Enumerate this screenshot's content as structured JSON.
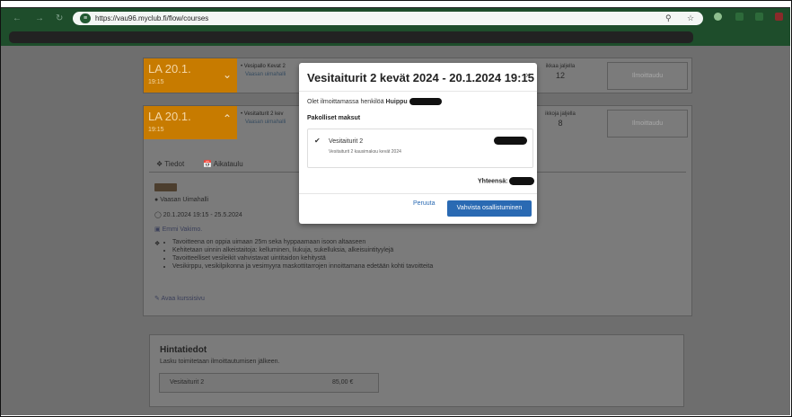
{
  "browser": {
    "url": "https://vau96.myclub.fi/flow/courses"
  },
  "events": [
    {
      "date": "LA 20.1.",
      "time": "19:15",
      "title": "• Vesipallo Kevat 2",
      "link": "Vaasan uimahalli",
      "spots_label": "ikkaa jaljella",
      "spots_value": "12",
      "button": "Ilmoittaudu"
    },
    {
      "date": "LA 20.1.",
      "time": "19:15",
      "title": "• Vesitaiturit 2 kev",
      "link": "Vaasan uimahalli",
      "spots_label": "ikkoja jaljella",
      "spots_value": "8",
      "button": "Ilmoittaudu"
    }
  ],
  "details": {
    "tab_info": "Tiedot",
    "tab_schedule": "Aikataulu",
    "location": "Vaasan Uimahalli",
    "dates": "20.1.2024 19:15 - 25.5.2024",
    "instructor": "Emmi Vakimo.",
    "bullets": [
      "Tavoitteena on oppia uimaan 25m seka hyppaamaan isoon altaaseen",
      "Kehitetaan uinnin alkeistaitoja: kelluminen, liukuja, sukelluksia, alkeisuintityylejä",
      "Tavoitteelliset vesileikit vahvistavat uintitaidon kehitystä",
      "Vesikirppu, vesikilpikonna ja vesimyyra maskottitarrojen innoittamana edetään kohti tavoitteita"
    ],
    "open_course": "Avaa kurssisivu"
  },
  "pricing": {
    "title": "Hintatiedot",
    "note": "Lasku toimitetaan ilmoittautumisen jälkeen.",
    "item": "Vesitaiturit 2",
    "price": "85,00 €"
  },
  "modal": {
    "title": "Vesitaiturit 2 kevät 2024 - 20.1.2024 19:15",
    "close": "×",
    "registering_text": "Olet ilmoittamassa henkilöä",
    "person_first_name": "Huippu",
    "mandatory_title": "Pakolliset maksut",
    "item_name": "Vesitaiturit 2",
    "item_description": "Vesitaiturit 2 kausimaksu kevät 2024",
    "total_label": "Yhteensä:",
    "cancel": "Peruuta",
    "confirm": "Vahvista osallistuminen"
  }
}
